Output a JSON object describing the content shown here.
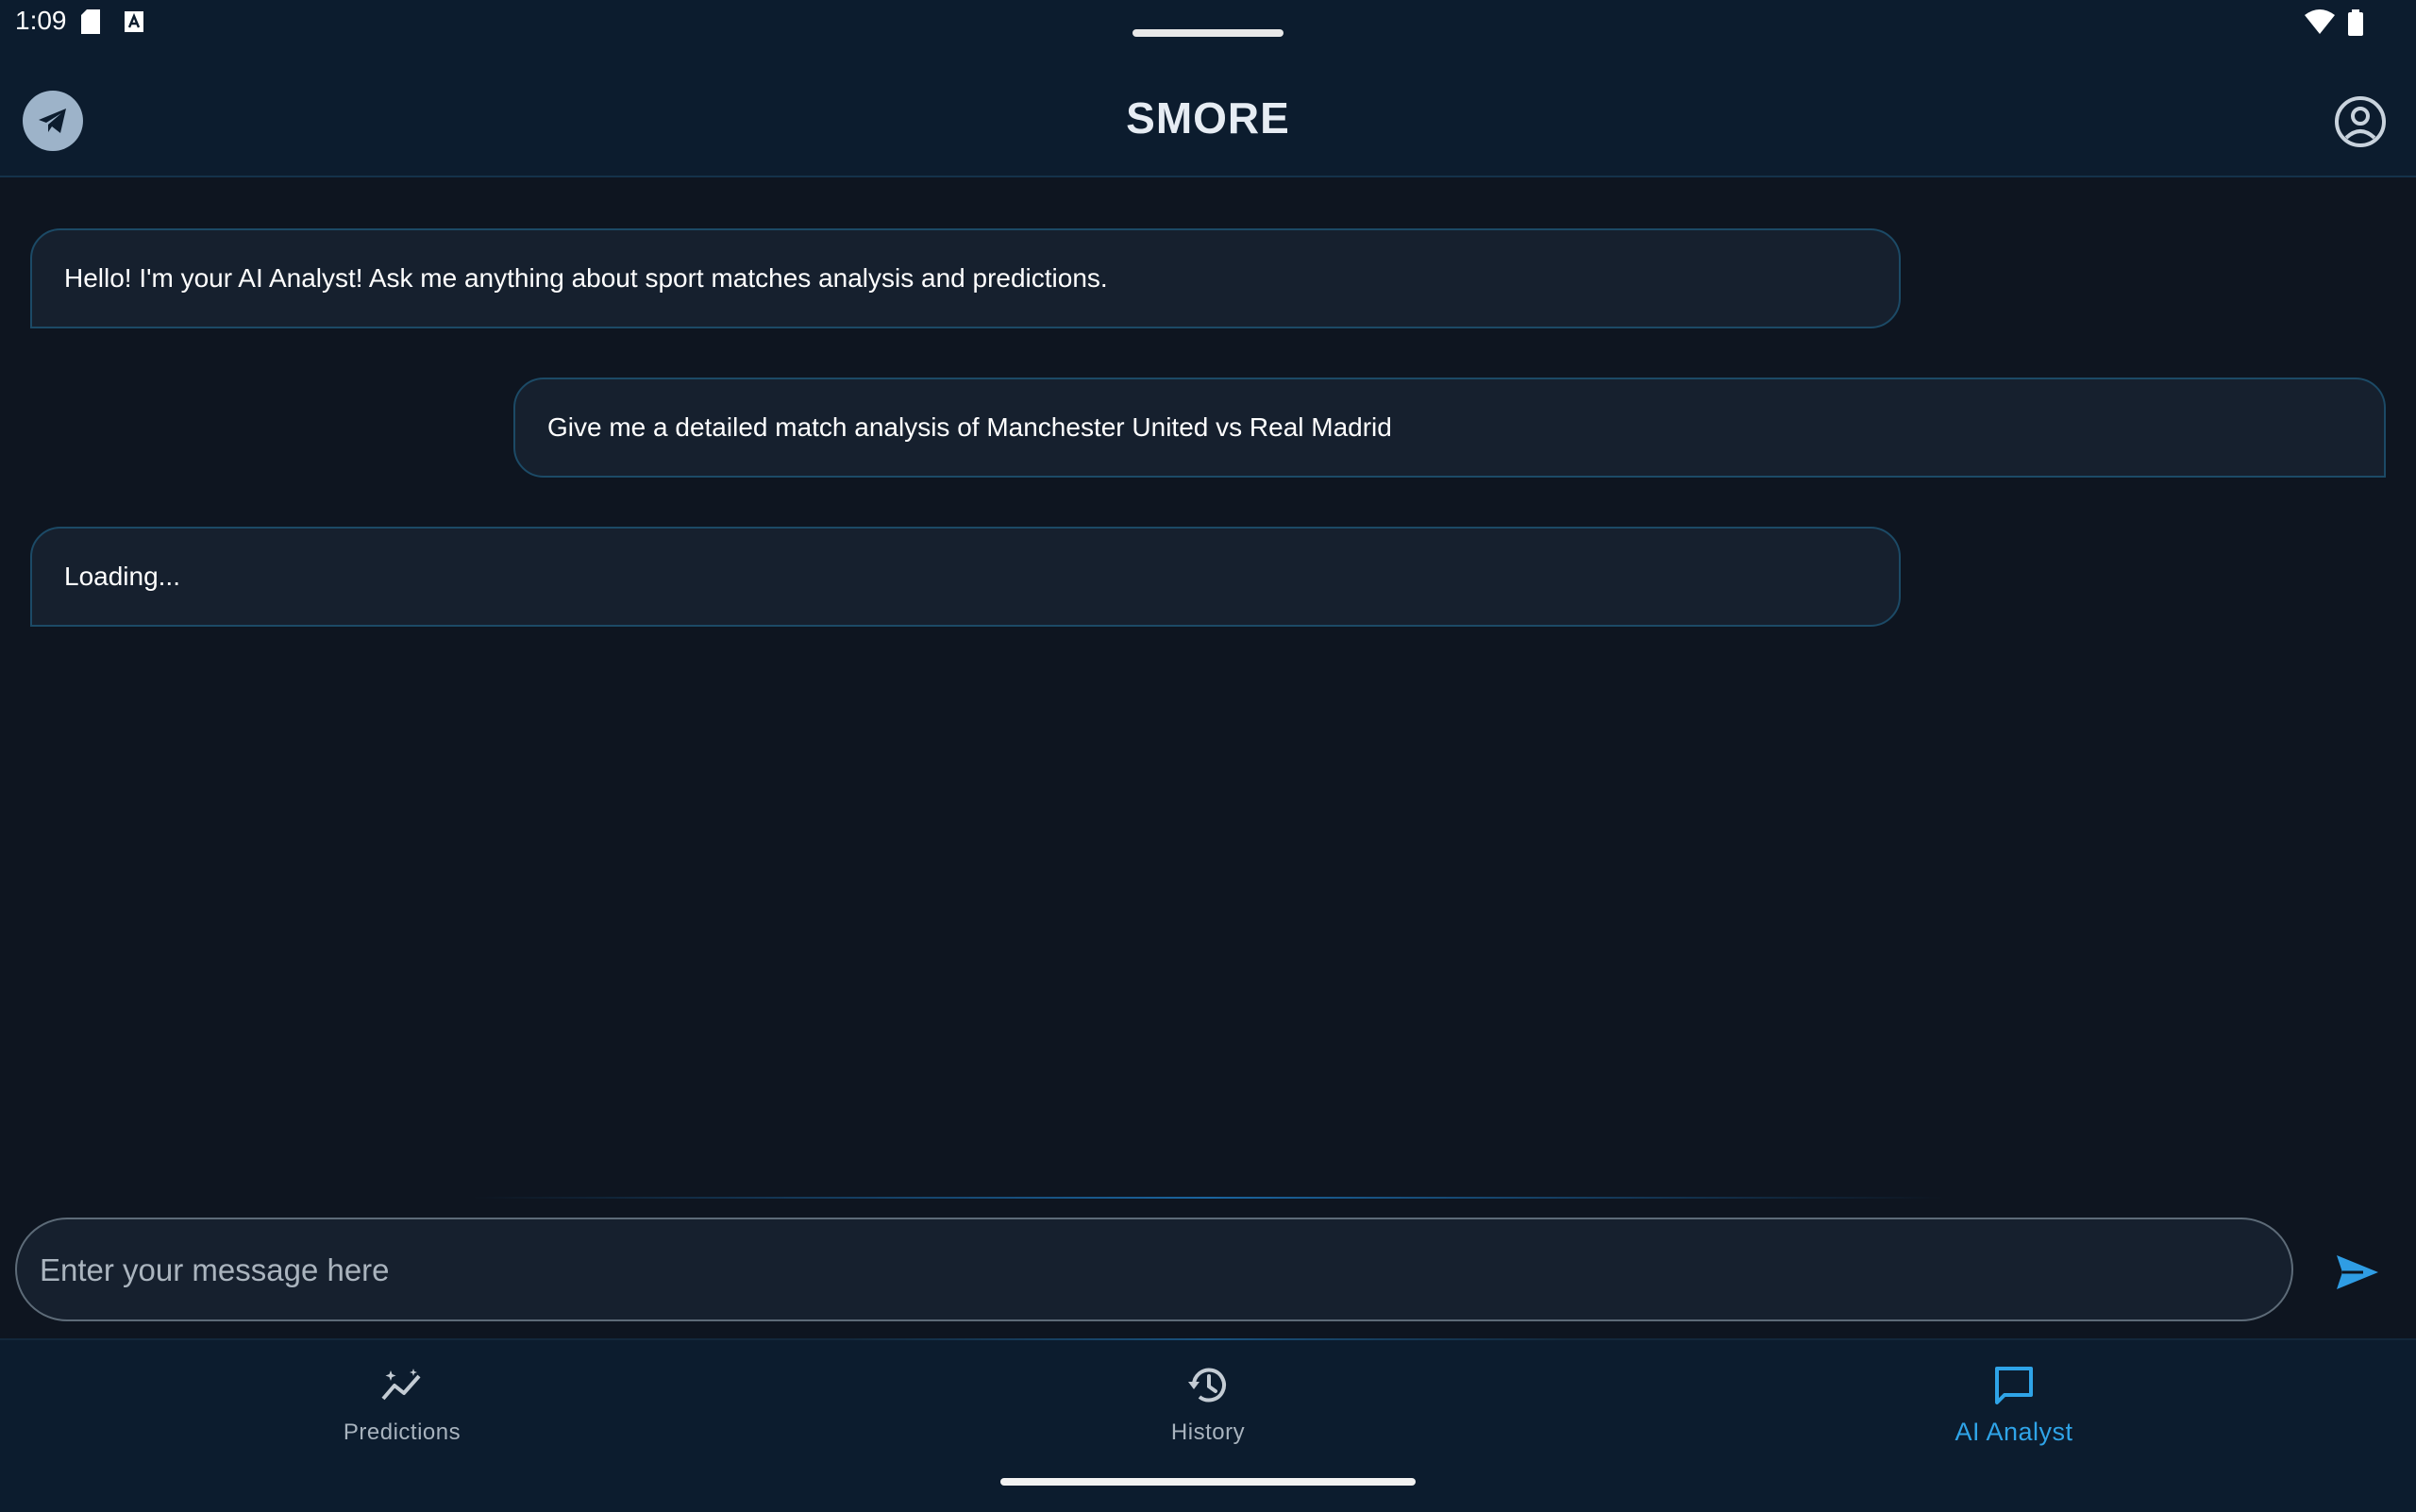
{
  "status_bar": {
    "time": "1:09"
  },
  "header": {
    "title": "SMORE"
  },
  "chat": {
    "messages": [
      {
        "role": "ai",
        "text": "Hello! I'm your AI Analyst! Ask me anything about sport matches analysis and predictions."
      },
      {
        "role": "user",
        "text": "Give me a detailed match analysis of Manchester United vs Real Madrid"
      },
      {
        "role": "ai",
        "text": "Loading..."
      }
    ]
  },
  "composer": {
    "placeholder": "Enter your message here",
    "value": ""
  },
  "nav": {
    "items": [
      {
        "label": "Predictions",
        "icon": "predictions-chart-icon",
        "active": false
      },
      {
        "label": "History",
        "icon": "history-icon",
        "active": false
      },
      {
        "label": "AI Analyst",
        "icon": "chat-bubble-icon",
        "active": true
      }
    ]
  },
  "colors": {
    "background": "#0e1520",
    "header_bg": "#0c1c2e",
    "bubble_bg": "#16202e",
    "bubble_border": "#1c4a66",
    "accent": "#2fa4e8",
    "nav_inactive": "#a8b3be"
  }
}
